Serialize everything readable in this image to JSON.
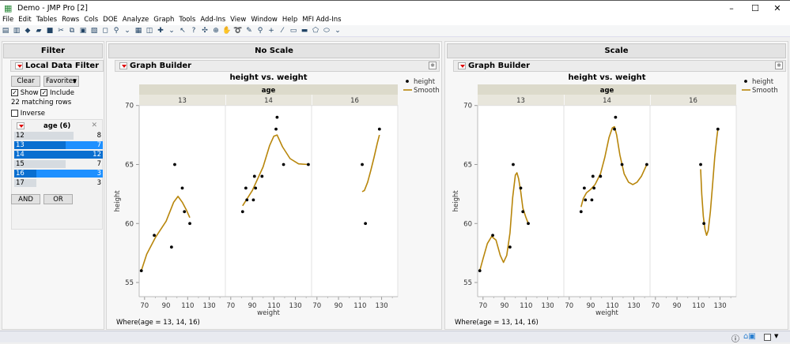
{
  "window": {
    "title": "Demo - JMP Pro [2]",
    "controls": [
      "–",
      "☐",
      "✕"
    ]
  },
  "menu": [
    "File",
    "Edit",
    "Tables",
    "Rows",
    "Cols",
    "DOE",
    "Analyze",
    "Graph",
    "Tools",
    "Add-Ins",
    "View",
    "Window",
    "Help",
    "MFI Add-Ins"
  ],
  "toolbar_icons": [
    "new-table",
    "new-script",
    "python",
    "open",
    "save",
    "cut",
    "copy",
    "paste",
    "script-editor",
    "lock",
    "search",
    "more",
    "data-table",
    "journal",
    "add-data",
    "more",
    "arrow-tool",
    "help-tool",
    "selection-tool",
    "crosshair",
    "grabber",
    "lasso",
    "brush",
    "magnifier",
    "plus-tool",
    "line-tool",
    "annotate",
    "simple-shape",
    "polygon",
    "oval",
    "more"
  ],
  "filter": {
    "header": "Filter",
    "title": "Local Data Filter",
    "clear": "Clear",
    "favorites": "Favorites",
    "show": "Show",
    "include": "Include",
    "matching": "22 matching rows",
    "inverse": "Inverse",
    "column_title": "age (6)",
    "rows": [
      {
        "label": "12",
        "count": 8,
        "selected": false
      },
      {
        "label": "13",
        "count": 7,
        "selected": true
      },
      {
        "label": "14",
        "count": 12,
        "selected": true
      },
      {
        "label": "15",
        "count": 7,
        "selected": false
      },
      {
        "label": "16",
        "count": 3,
        "selected": true
      },
      {
        "label": "17",
        "count": 3,
        "selected": false
      }
    ],
    "and": "AND",
    "or": "OR"
  },
  "graphs": [
    {
      "header": "No Scale",
      "outline": "Graph Builder",
      "where": "Where(age = 13, 14, 16)"
    },
    {
      "header": "Scale",
      "outline": "Graph Builder",
      "where": "Where(age = 13, 14, 16)"
    }
  ],
  "colors": {
    "smooth": "#b8860b",
    "points": "#000000",
    "selected": "#1e90ff",
    "selected_bar": "#0a6fd0",
    "facet_band": "#dcdacb",
    "facet_sub": "#e8e6dc"
  },
  "chart_data": [
    {
      "type": "scatter",
      "title": "height vs. weight",
      "xlabel": "weight",
      "ylabel": "height",
      "group_label": "age",
      "xlim": [
        65,
        145
      ],
      "ylim": [
        53.8,
        70
      ],
      "xticks": [
        70,
        90,
        110,
        130
      ],
      "yticks": [
        55,
        60,
        65,
        70
      ],
      "legend": {
        "position": "right",
        "entries": [
          "height",
          "Smooth"
        ]
      },
      "panels": [
        {
          "group": "13",
          "points": [
            [
              67,
              56
            ],
            [
              79,
              59
            ],
            [
              95,
              58
            ],
            [
              98,
              65
            ],
            [
              105,
              63
            ],
            [
              107,
              61
            ],
            [
              112,
              60
            ]
          ],
          "smooth": [
            [
              67,
              56
            ],
            [
              72,
              57.4
            ],
            [
              80,
              58.8
            ],
            [
              90,
              60.2
            ],
            [
              97,
              61.8
            ],
            [
              101,
              62.3
            ],
            [
              105,
              61.8
            ],
            [
              109,
              61.1
            ],
            [
              112,
              60.5
            ]
          ]
        },
        {
          "group": "14",
          "points": [
            [
              81,
              61
            ],
            [
              84,
              63
            ],
            [
              85,
              62
            ],
            [
              91,
              62
            ],
            [
              92,
              64
            ],
            [
              93,
              63
            ],
            [
              99,
              64
            ],
            [
              112,
              68
            ],
            [
              113,
              69
            ],
            [
              119,
              65
            ],
            [
              142,
              65
            ]
          ],
          "smooth": [
            [
              81,
              61.5
            ],
            [
              90,
              62.8
            ],
            [
              100,
              64.8
            ],
            [
              106,
              66.6
            ],
            [
              110,
              67.4
            ],
            [
              113,
              67.5
            ],
            [
              118,
              66.5
            ],
            [
              125,
              65.5
            ],
            [
              133,
              65.05
            ],
            [
              142,
              65
            ]
          ]
        },
        {
          "group": "16",
          "points": [
            [
              112,
              65
            ],
            [
              115,
              60
            ],
            [
              128,
              68
            ]
          ],
          "smooth": [
            [
              112,
              62.7
            ],
            [
              114,
              62.8
            ],
            [
              117,
              63.5
            ],
            [
              120,
              64.5
            ],
            [
              123,
              65.6
            ],
            [
              126,
              66.8
            ],
            [
              128,
              67.5
            ]
          ]
        }
      ]
    },
    {
      "type": "scatter",
      "title": "height vs. weight",
      "xlabel": "weight",
      "ylabel": "height",
      "group_label": "age",
      "xlim": [
        65,
        145
      ],
      "ylim": [
        53.8,
        70
      ],
      "xticks": [
        70,
        90,
        110,
        130
      ],
      "yticks": [
        55,
        60,
        65,
        70
      ],
      "legend": {
        "position": "right",
        "entries": [
          "height",
          "Smooth"
        ]
      },
      "panels": [
        {
          "group": "13",
          "points": [
            [
              67,
              56
            ],
            [
              79,
              59
            ],
            [
              95,
              58
            ],
            [
              98,
              65
            ],
            [
              105,
              63
            ],
            [
              107,
              61
            ],
            [
              112,
              60
            ]
          ],
          "smooth": [
            [
              67,
              56
            ],
            [
              70,
              57
            ],
            [
              74,
              58.3
            ],
            [
              78,
              58.9
            ],
            [
              82,
              58.6
            ],
            [
              86,
              57.3
            ],
            [
              89,
              56.7
            ],
            [
              92,
              57.3
            ],
            [
              95,
              59.2
            ],
            [
              97.5,
              62.2
            ],
            [
              100,
              64.1
            ],
            [
              101.5,
              64.3
            ],
            [
              103,
              63.8
            ],
            [
              105,
              62.7
            ],
            [
              107,
              61.3
            ],
            [
              109.5,
              60.6
            ],
            [
              112,
              60
            ]
          ]
        },
        {
          "group": "14",
          "points": [
            [
              81,
              61
            ],
            [
              84,
              63
            ],
            [
              85,
              62
            ],
            [
              91,
              62
            ],
            [
              92,
              64
            ],
            [
              93,
              63
            ],
            [
              99,
              64
            ],
            [
              112,
              68
            ],
            [
              113,
              69
            ],
            [
              119,
              65
            ],
            [
              142,
              65
            ]
          ],
          "smooth": [
            [
              81,
              61.4
            ],
            [
              83,
              62.1
            ],
            [
              86,
              62.6
            ],
            [
              90,
              62.9
            ],
            [
              94,
              63.3
            ],
            [
              99,
              64.2
            ],
            [
              103,
              65.6
            ],
            [
              107,
              67.3
            ],
            [
              110,
              68.1
            ],
            [
              112,
              68.2
            ],
            [
              114,
              67.5
            ],
            [
              117,
              65.8
            ],
            [
              121,
              64.2
            ],
            [
              125,
              63.5
            ],
            [
              129,
              63.3
            ],
            [
              133,
              63.5
            ],
            [
              137,
              64
            ],
            [
              142,
              65
            ]
          ]
        },
        {
          "group": "16",
          "points": [
            [
              112,
              65
            ],
            [
              115,
              60
            ],
            [
              128,
              68
            ]
          ],
          "smooth": [
            [
              112,
              64.6
            ],
            [
              113,
              62.5
            ],
            [
              114.5,
              60.6
            ],
            [
              116,
              59.5
            ],
            [
              117.5,
              59
            ],
            [
              119,
              59.4
            ],
            [
              121,
              61
            ],
            [
              123,
              63.2
            ],
            [
              125,
              65.6
            ],
            [
              127,
              67.3
            ],
            [
              128,
              68
            ]
          ]
        }
      ]
    }
  ]
}
